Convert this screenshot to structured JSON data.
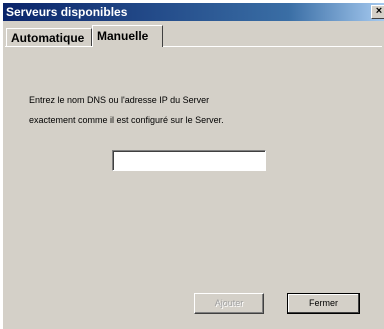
{
  "window": {
    "title": "Serveurs disponibles",
    "close_glyph": "×"
  },
  "tabs": [
    {
      "label": "Automatique",
      "active": false
    },
    {
      "label": "Manuelle",
      "active": true
    }
  ],
  "manual": {
    "instruction_line1": "Entrez le nom DNS ou l'adresse IP du Server",
    "instruction_line2": "exactement comme il est configuré sur le Server.",
    "server_input_value": ""
  },
  "buttons": {
    "add_label": "Ajouter",
    "add_enabled": false,
    "close_label": "Fermer"
  },
  "colors": {
    "title_bar": "#0a246a",
    "face": "#d4d0c8"
  }
}
